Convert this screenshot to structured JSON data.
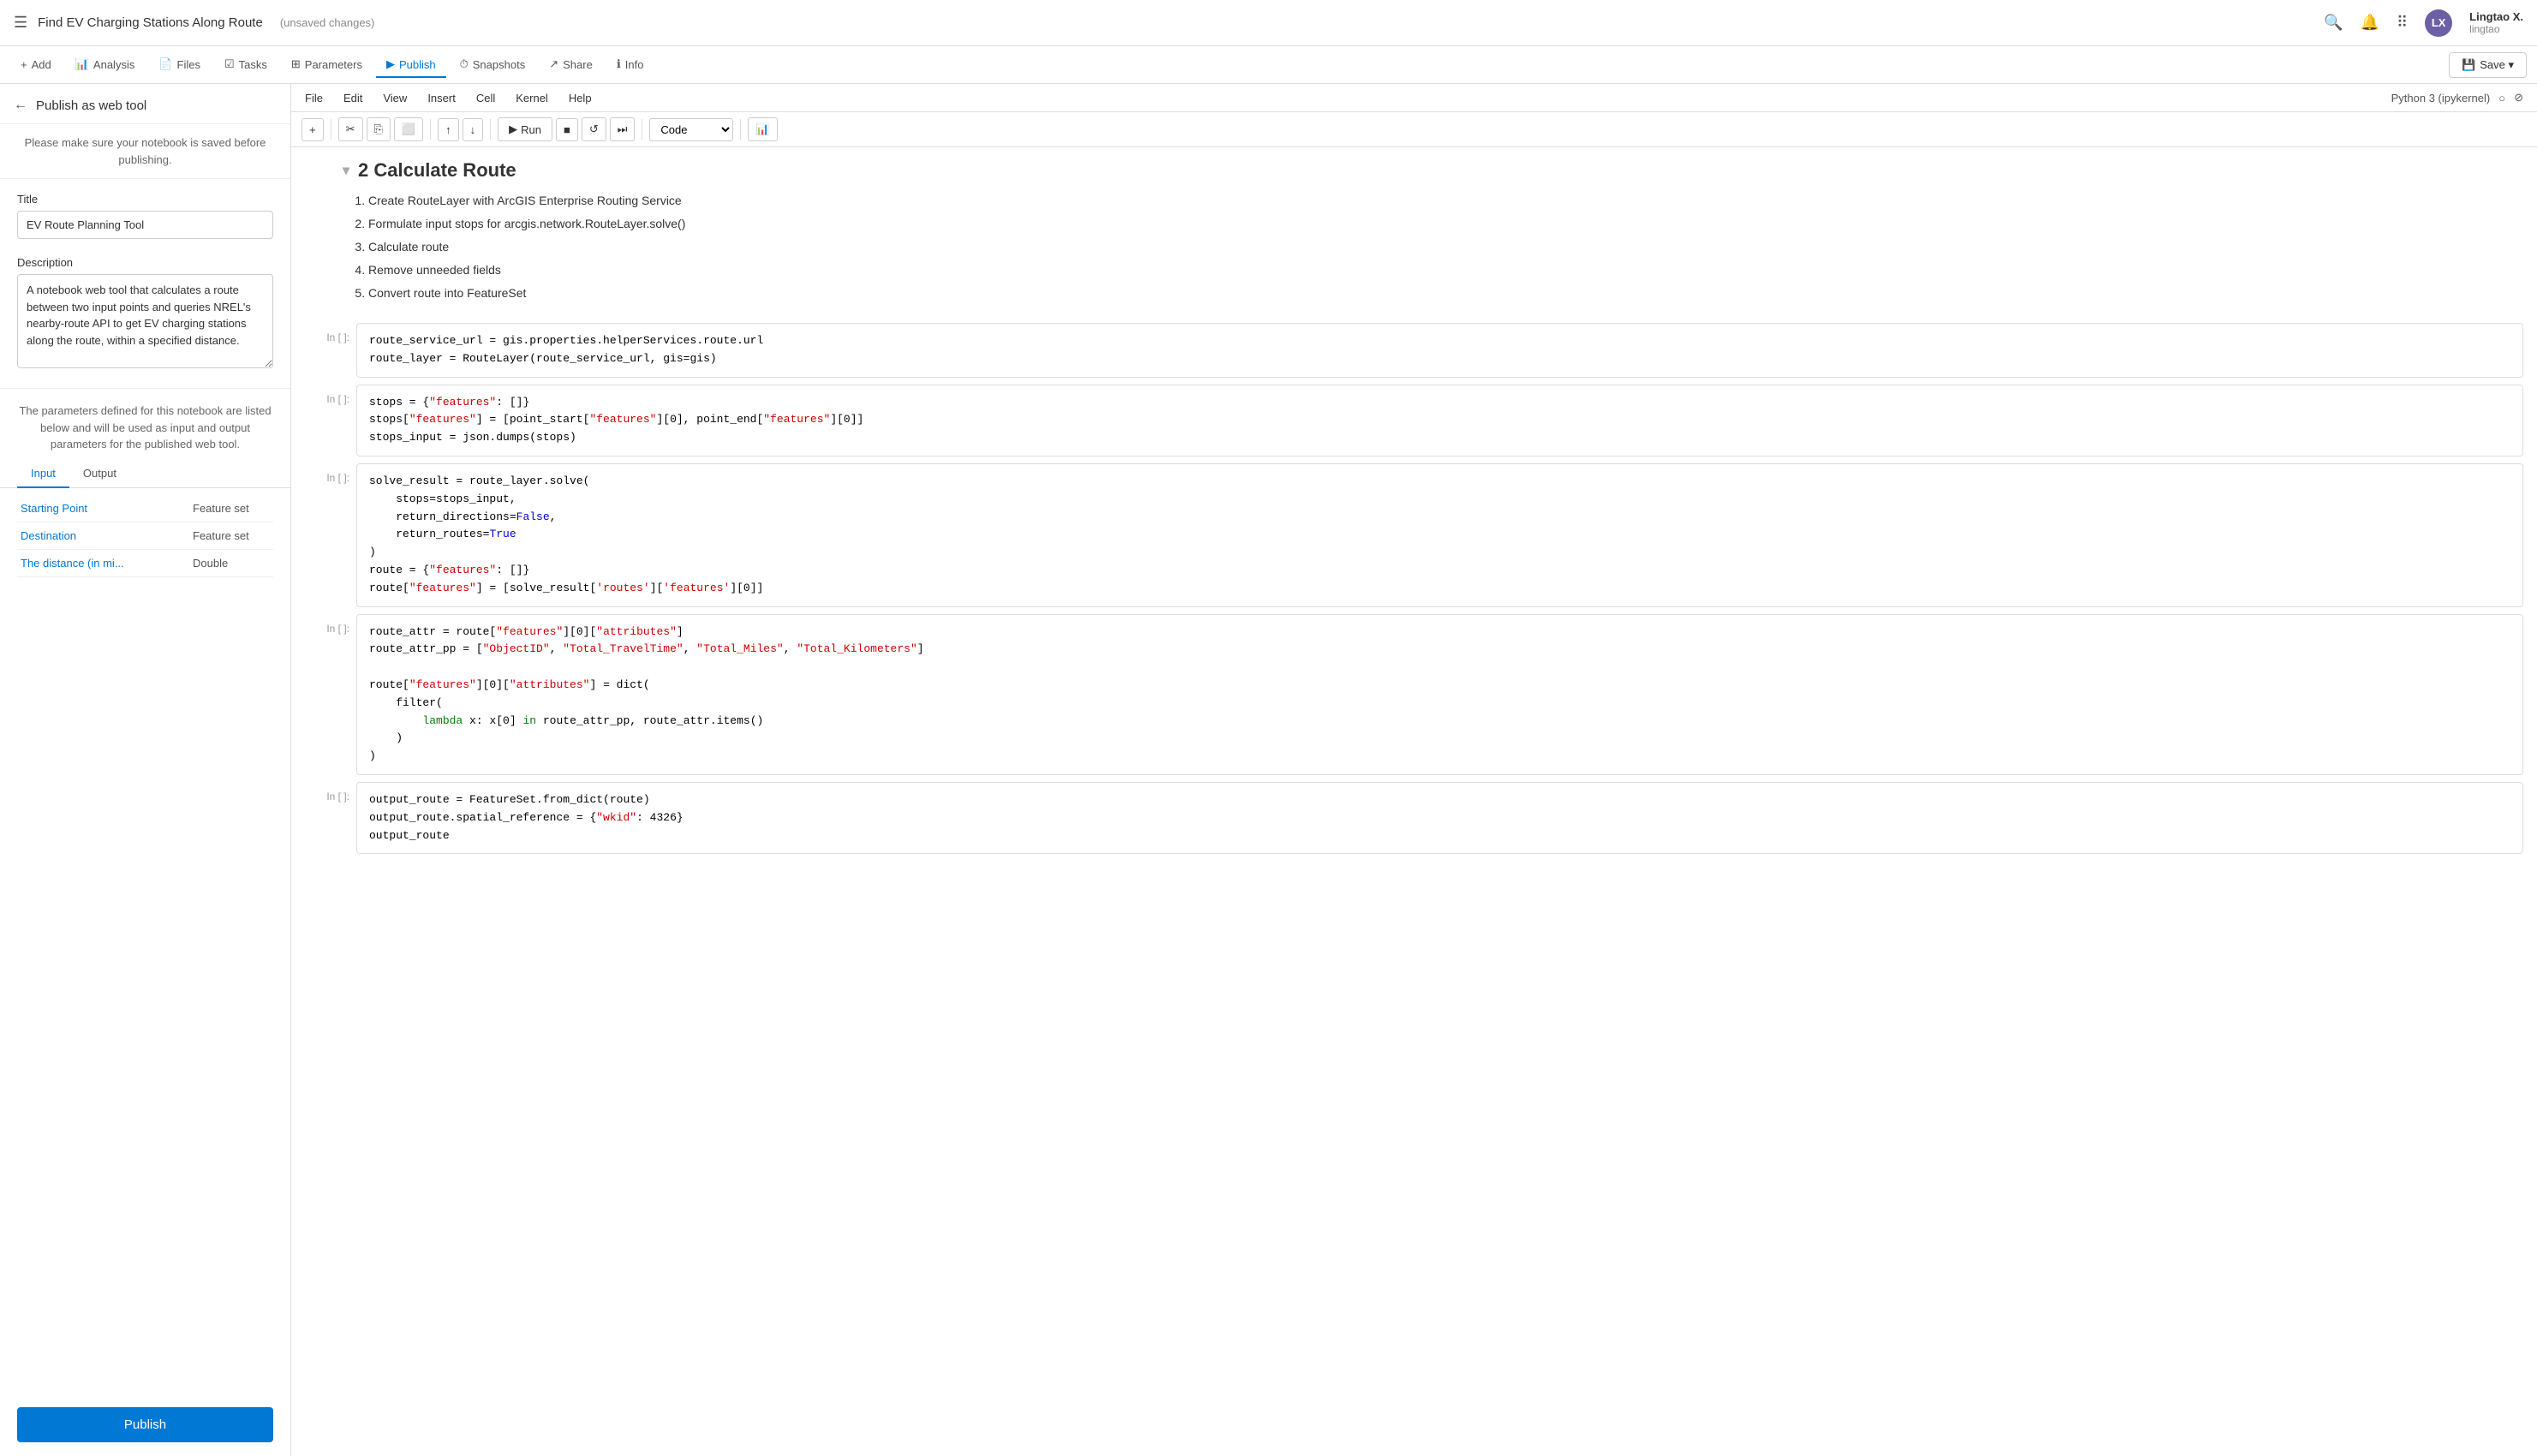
{
  "topbar": {
    "menu_icon": "☰",
    "title": "Find EV Charging Stations Along Route",
    "unsaved": "(unsaved changes)",
    "user_name": "Lingtao X.",
    "user_handle": "lingtao",
    "user_initials": "LX"
  },
  "toolbar_nav": {
    "items": [
      {
        "label": "Add",
        "icon": "+",
        "active": false
      },
      {
        "label": "Analysis",
        "icon": "📊",
        "active": false
      },
      {
        "label": "Files",
        "icon": "📄",
        "active": false
      },
      {
        "label": "Tasks",
        "icon": "☑",
        "active": false
      },
      {
        "label": "Parameters",
        "icon": "⊞",
        "active": false
      },
      {
        "label": "Publish",
        "icon": "▶",
        "active": true
      },
      {
        "label": "Snapshots",
        "icon": "⏱",
        "active": false
      },
      {
        "label": "Share",
        "icon": "↗",
        "active": false
      },
      {
        "label": "Info",
        "icon": "ℹ",
        "active": false
      }
    ],
    "save_label": "Save ▾"
  },
  "left_panel": {
    "back_label": "←",
    "title": "Publish as web tool",
    "notice": "Please make sure your notebook is saved before publishing.",
    "title_label": "Title",
    "title_value": "EV Route Planning Tool",
    "description_label": "Description",
    "description_value": "A notebook web tool that calculates a route between two input points and queries NREL's nearby-route API to get EV charging stations along the route, within a specified distance.",
    "params_notice": "The parameters defined for this notebook are listed below and will be used as input and output parameters for the published web tool.",
    "tabs": [
      "Input",
      "Output"
    ],
    "active_tab": "Input",
    "params": [
      {
        "name": "Starting Point",
        "type": "Feature set"
      },
      {
        "name": "Destination",
        "type": "Feature set"
      },
      {
        "name": "The distance (in mi...",
        "type": "Double"
      }
    ],
    "publish_btn": "Publish"
  },
  "jupyter": {
    "menu_items": [
      "File",
      "Edit",
      "View",
      "Insert",
      "Cell",
      "Kernel",
      "Help"
    ],
    "kernel_label": "Python 3 (ipykernel)",
    "toolbar": {
      "buttons": [
        "+",
        "✂",
        "⎘",
        "⬜",
        "↑",
        "↓"
      ],
      "run_label": "Run",
      "cell_type": "Code"
    },
    "section_title": "2 Calculate Route",
    "section_steps": [
      "Create RouteLayer with ArcGIS Enterprise Routing Service",
      "Formulate input stops for arcgis.network.RouteLayer.solve()",
      "Calculate route",
      "Remove unneeded fields",
      "Convert route into FeatureSet"
    ],
    "cells": [
      {
        "prompt": "In [ ]:",
        "code_lines": [
          {
            "text": "route_service_url = gis.properties.helperServices.route.url",
            "type": "plain"
          },
          {
            "text": "route_layer = RouteLayer(route_service_url, gis=gis)",
            "type": "plain"
          }
        ]
      },
      {
        "prompt": "In [ ]:",
        "code_lines": [
          {
            "text": "stops = {\"features\": []}",
            "type": "plain"
          },
          {
            "text": "stops[\"features\"] = [point_start[\"features\"][0], point_end[\"features\"][0]]",
            "type": "plain"
          },
          {
            "text": "stops_input = json.dumps(stops)",
            "type": "plain"
          }
        ]
      },
      {
        "prompt": "In [ ]:",
        "code_lines": [
          {
            "text": "solve_result = route_layer.solve(",
            "type": "plain"
          },
          {
            "text": "    stops=stops_input,",
            "type": "plain"
          },
          {
            "text": "    return_directions=False,",
            "type": "plain"
          },
          {
            "text": "    return_routes=True",
            "type": "plain"
          },
          {
            "text": ")",
            "type": "plain"
          },
          {
            "text": "route = {\"features\": []}",
            "type": "plain"
          },
          {
            "text": "route[\"features\"] = [solve_result['routes']['features'][0]]",
            "type": "plain"
          }
        ]
      },
      {
        "prompt": "In [ ]:",
        "code_lines": [
          {
            "text": "route_attr = route[\"features\"][0][\"attributes\"]",
            "type": "plain"
          },
          {
            "text": "route_attr_pp = [\"ObjectID\", \"Total_TravelTime\", \"Total_Miles\", \"Total_Kilometers\"]",
            "type": "plain"
          },
          {
            "text": "",
            "type": "plain"
          },
          {
            "text": "route[\"features\"][0][\"attributes\"] = dict(",
            "type": "plain"
          },
          {
            "text": "    filter(",
            "type": "plain"
          },
          {
            "text": "        lambda x: x[0] in route_attr_pp, route_attr.items()",
            "type": "plain"
          },
          {
            "text": "    )",
            "type": "plain"
          },
          {
            "text": ")",
            "type": "plain"
          }
        ]
      },
      {
        "prompt": "In [ ]:",
        "code_lines": [
          {
            "text": "output_route = FeatureSet.from_dict(route)",
            "type": "plain"
          },
          {
            "text": "output_route.spatial_reference = {\"wkid\": 4326}",
            "type": "plain"
          },
          {
            "text": "output_route",
            "type": "plain"
          }
        ]
      }
    ]
  }
}
